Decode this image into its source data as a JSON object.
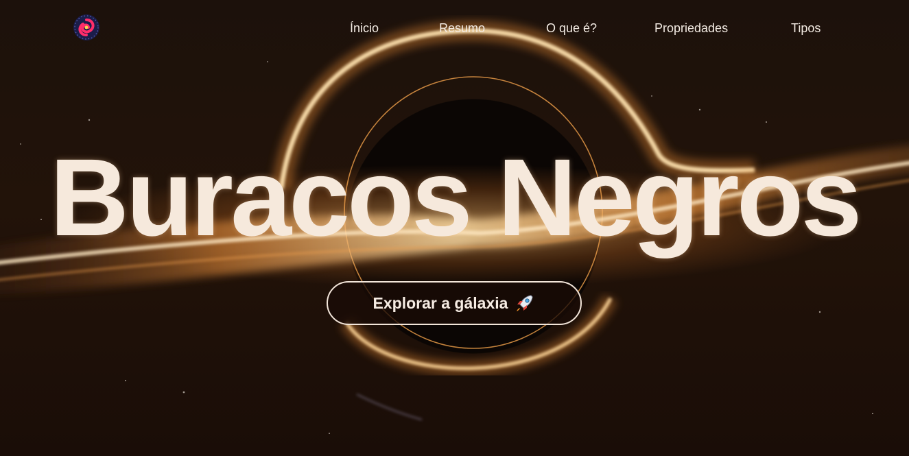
{
  "page": {
    "title": "Buracos Negros",
    "background_scene": "black-hole-accretion-disk",
    "accent_color": "#f8a14a",
    "text_color": "#f6e9dc"
  },
  "header": {
    "logo_icon": "galaxy-logo-icon",
    "nav": [
      {
        "id": "inicio",
        "label": "Ínicio"
      },
      {
        "id": "resumo",
        "label": "Resumo"
      },
      {
        "id": "o-que-e",
        "label": "O que é?"
      },
      {
        "id": "propriedades",
        "label": "Propriedades"
      },
      {
        "id": "tipos",
        "label": "Tipos"
      }
    ]
  },
  "hero": {
    "heading": "Buracos Negros",
    "cta": {
      "label": "Explorar a gálaxia",
      "icon": "rocket-icon"
    }
  }
}
